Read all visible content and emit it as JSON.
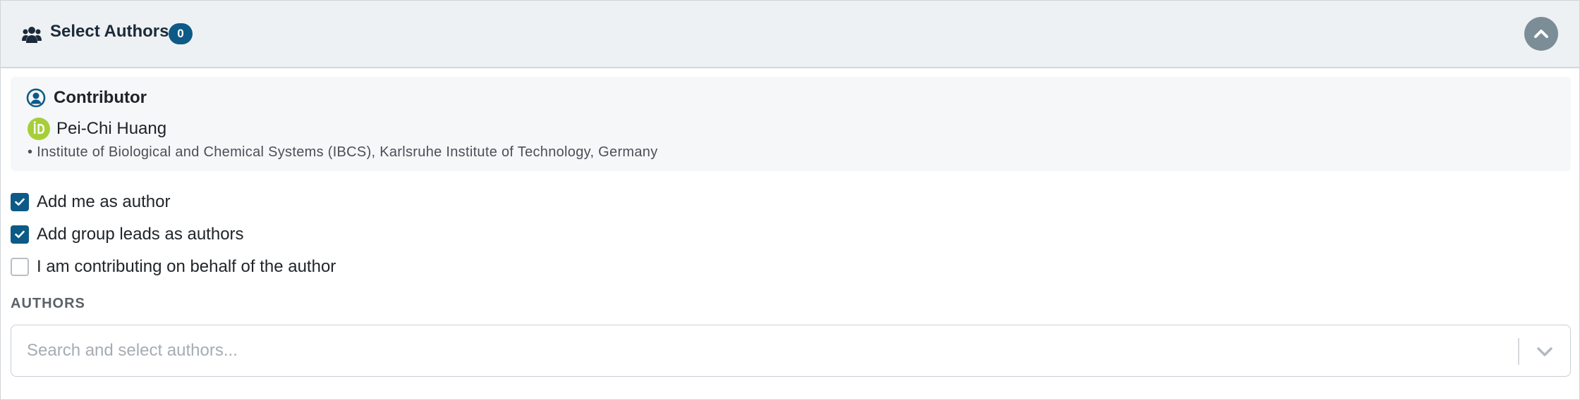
{
  "header": {
    "title": "Select Authors",
    "badge_count": "0",
    "icon": "users-icon",
    "collapse_icon": "chevron-up-icon"
  },
  "contributor": {
    "heading": "Contributor",
    "heading_icon": "user-circle-icon",
    "orcid_icon": "orcid-icon",
    "name": "Pei-Chi Huang",
    "affiliation": "• Institute of Biological and Chemical Systems (IBCS), Karlsruhe Institute of Technology, Germany"
  },
  "options": [
    {
      "label": "Add me as author",
      "checked": true
    },
    {
      "label": "Add group leads as authors",
      "checked": true
    },
    {
      "label": "I am contributing on behalf of the author",
      "checked": false
    }
  ],
  "authors": {
    "label": "AUTHORS",
    "placeholder": "Search and select authors...",
    "value": "",
    "dropdown_icon": "chevron-down-icon"
  },
  "colors": {
    "accent": "#0d5a86",
    "header_bg": "#eef1f3",
    "orcid_green": "#a6ce39",
    "collapse_button": "#7b8d96"
  }
}
